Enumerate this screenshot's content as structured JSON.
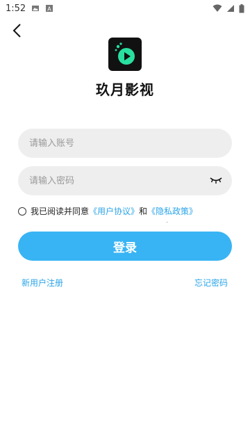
{
  "status_bar": {
    "time": "1:52",
    "left_icons": [
      "gallery-icon",
      "a-icon"
    ],
    "right_icons": [
      "wifi-icon",
      "signal-icon",
      "battery-icon"
    ]
  },
  "app": {
    "name": "玖月影视",
    "logo_icon": "play-logo-icon",
    "accent_color": "#38b4f4",
    "logo_bg": "#111111",
    "logo_play_color": "#29e0a0"
  },
  "form": {
    "account_placeholder": "请输入账号",
    "password_placeholder": "请输入密码",
    "password_toggle_icon": "eye-closed-icon"
  },
  "agreement": {
    "prefix": "我已阅读并同意",
    "user_agreement": "《用户协议》",
    "joiner": "和",
    "privacy_policy": "《隐私政策》"
  },
  "actions": {
    "login_label": "登录",
    "register_label": "新用户注册",
    "forgot_label": "忘记密码"
  }
}
